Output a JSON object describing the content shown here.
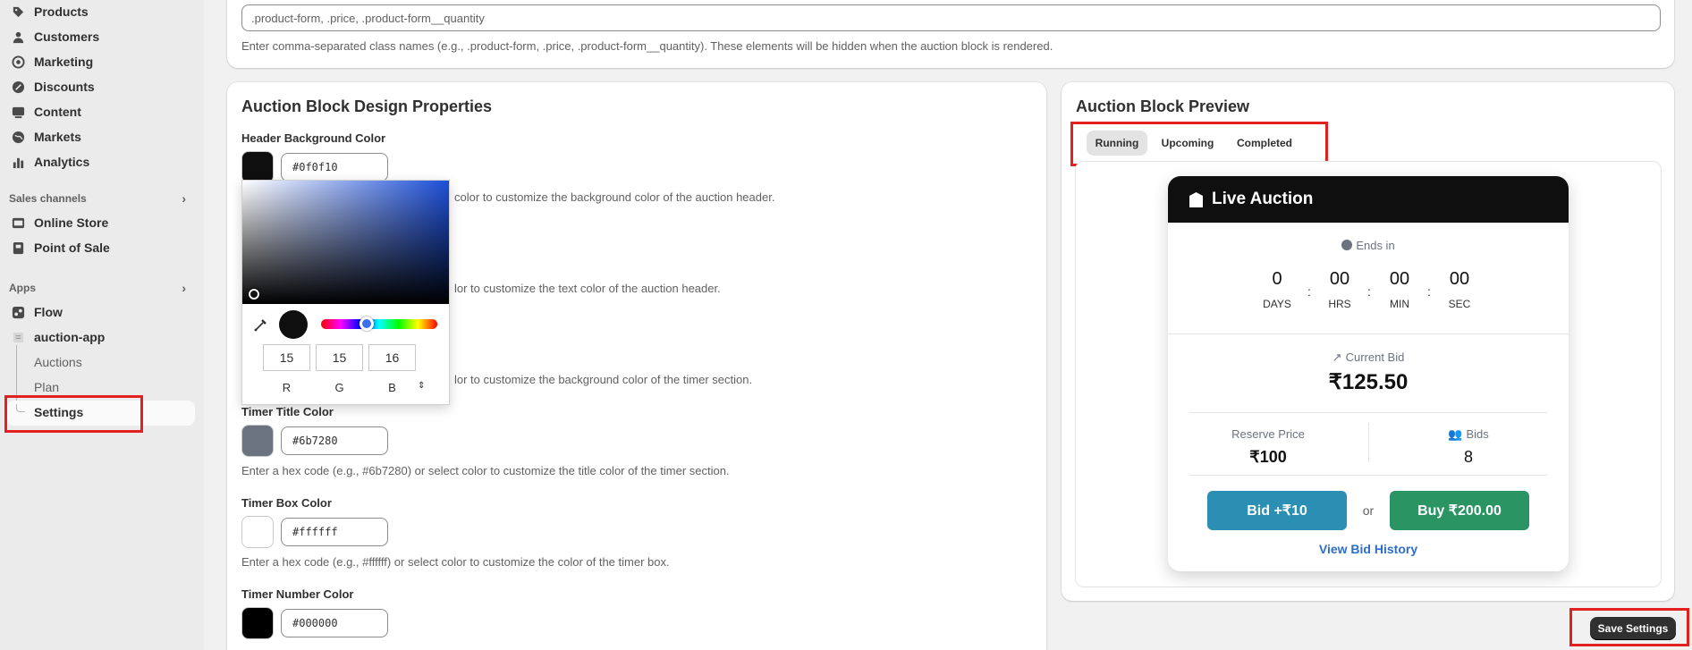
{
  "sidebar": {
    "items": [
      {
        "label": "Products",
        "icon": "tag-icon"
      },
      {
        "label": "Customers",
        "icon": "person-icon"
      },
      {
        "label": "Marketing",
        "icon": "target-icon"
      },
      {
        "label": "Discounts",
        "icon": "discount-icon"
      },
      {
        "label": "Content",
        "icon": "content-icon"
      },
      {
        "label": "Markets",
        "icon": "globe-icon"
      },
      {
        "label": "Analytics",
        "icon": "bar-chart-icon"
      }
    ],
    "sales_channels_label": "Sales channels",
    "channels": [
      {
        "label": "Online Store",
        "icon": "store-icon"
      },
      {
        "label": "Point of Sale",
        "icon": "pos-icon"
      }
    ],
    "apps_label": "Apps",
    "apps": [
      {
        "label": "Flow",
        "icon": "flow-icon"
      },
      {
        "label": "auction-app",
        "icon": "app-icon"
      }
    ],
    "app_subitems": [
      "Auctions",
      "Plan",
      "Settings"
    ]
  },
  "hide_elements": {
    "input_value": ".product-form, .price, .product-form__quantity",
    "help": "Enter comma-separated class names (e.g., .product-form, .price, .product-form__quantity). These elements will be hidden when the auction block is rendered."
  },
  "design": {
    "title": "Auction Block Design Properties",
    "header_bg": {
      "label": "Header Background Color",
      "value": "#0f0f10",
      "help_visible": "color to customize the background color of the auction header."
    },
    "header_text_help_visible": "lor to customize the text color of the auction header.",
    "timer_bg_help_visible": "lor to customize the background color of the timer section.",
    "timer_title": {
      "label": "Timer Title Color",
      "value": "#6b7280",
      "help": "Enter a hex code (e.g., #6b7280) or select color to customize the title color of the timer section."
    },
    "timer_box": {
      "label": "Timer Box Color",
      "value": "#ffffff",
      "help": "Enter a hex code (e.g., #ffffff) or select color to customize the color of the timer box."
    },
    "timer_number": {
      "label": "Timer Number Color",
      "value": "#000000"
    }
  },
  "picker": {
    "r": "15",
    "g": "15",
    "b": "16",
    "r_label": "R",
    "g_label": "G",
    "b_label": "B",
    "swatch": "#0f0f10"
  },
  "preview": {
    "title": "Auction Block Preview",
    "tabs": [
      "Running",
      "Upcoming",
      "Completed"
    ],
    "header": "Live Auction",
    "ends_in": "Ends in",
    "timer": [
      {
        "value": "0",
        "label": "DAYS"
      },
      {
        "value": "00",
        "label": "HRS"
      },
      {
        "value": "00",
        "label": "MIN"
      },
      {
        "value": "00",
        "label": "SEC"
      }
    ],
    "timer_sep": ":",
    "current_bid_label": "Current Bid",
    "current_bid": "₹125.50",
    "reserve_label": "Reserve Price",
    "reserve": "₹100",
    "bids_label": "Bids",
    "bids": "8",
    "bid_button": "Bid +₹10",
    "or": "or",
    "buy_button": "Buy ₹200.00",
    "history_link": "View Bid History",
    "colors": {
      "bid": "#2a8fb3",
      "buy": "#2a9563",
      "link": "#2c6ecb"
    }
  },
  "save_label": "Save Settings"
}
